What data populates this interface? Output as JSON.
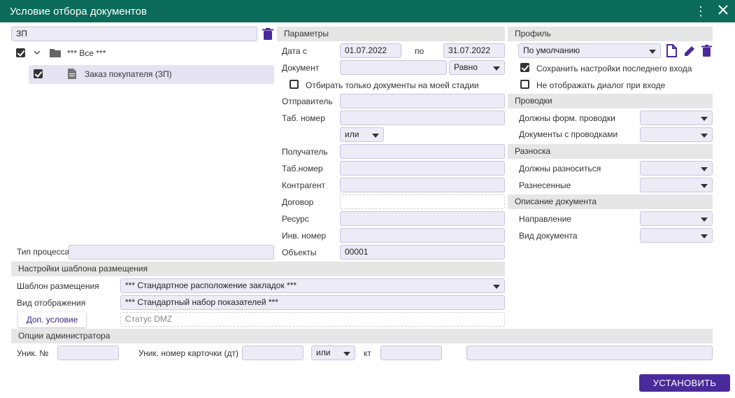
{
  "window": {
    "title": "Условие отбора документов",
    "menu_icon": "kebab-icon",
    "close_icon": "close-icon"
  },
  "left": {
    "search_value": "ЗП",
    "tree": [
      {
        "label": "*** Все ***",
        "checked": true,
        "icon": "folder-icon"
      },
      {
        "label": "Заказ покупателя (ЗП)",
        "checked": true,
        "icon": "document-icon"
      }
    ],
    "process_type_label": "Тип процесса",
    "process_type_value": ""
  },
  "params": {
    "header": "Параметры",
    "date_from_label": "Дата с",
    "date_from": "01.07.2022",
    "date_to_label": "по",
    "date_to": "31.07.2022",
    "document_label": "Документ",
    "document_value": "",
    "document_op": "Равно",
    "only_my_stage_label": "Отбирать только документы на моей стадии",
    "sender_label": "Отправитель",
    "tab_number_label": "Таб. номер",
    "or_select": "или",
    "receiver_label": "Получатель",
    "tab_number2_label": "Таб.номер",
    "counterparty_label": "Контрагент",
    "contract_label": "Договор",
    "resource_label": "Ресурс",
    "inv_number_label": "Инв. номер",
    "objects_label": "Объекты",
    "objects_value": "00001"
  },
  "profile": {
    "header": "Профиль",
    "value": "По умолчанию",
    "save_last_label": "Сохранить настройки последнего входа",
    "save_last_checked": true,
    "no_dialog_label": "Не отображать диалог при входе",
    "no_dialog_checked": false
  },
  "postings": {
    "header": "Проводки",
    "must_form_label": "Должны форм. проводки",
    "docs_with_label": "Документы с проводками"
  },
  "distribution": {
    "header": "Разноска",
    "must_label": "Должны разноситься",
    "done_label": "Разнесенные"
  },
  "doc_desc": {
    "header": "Описание документа",
    "direction_label": "Направление",
    "doc_type_label": "Вид документа"
  },
  "template": {
    "header": "Настройки шаблона размещения",
    "template_label": "Шаблон размещения",
    "template_value": "*** Стандартное расположение закладок ***",
    "view_label": "Вид отображения",
    "view_value": "*** Стандартный набор показателей ***",
    "extra_button": "Доп. условие",
    "status_placeholder": "Статус DMZ"
  },
  "admin": {
    "header": "Опции администратора",
    "uniq_label": "Уник. №",
    "card_label": "Уник. номер карточки (дт)",
    "or_select": "или",
    "kt_label": "кт"
  },
  "install_button": "УСТАНОВИТЬ"
}
